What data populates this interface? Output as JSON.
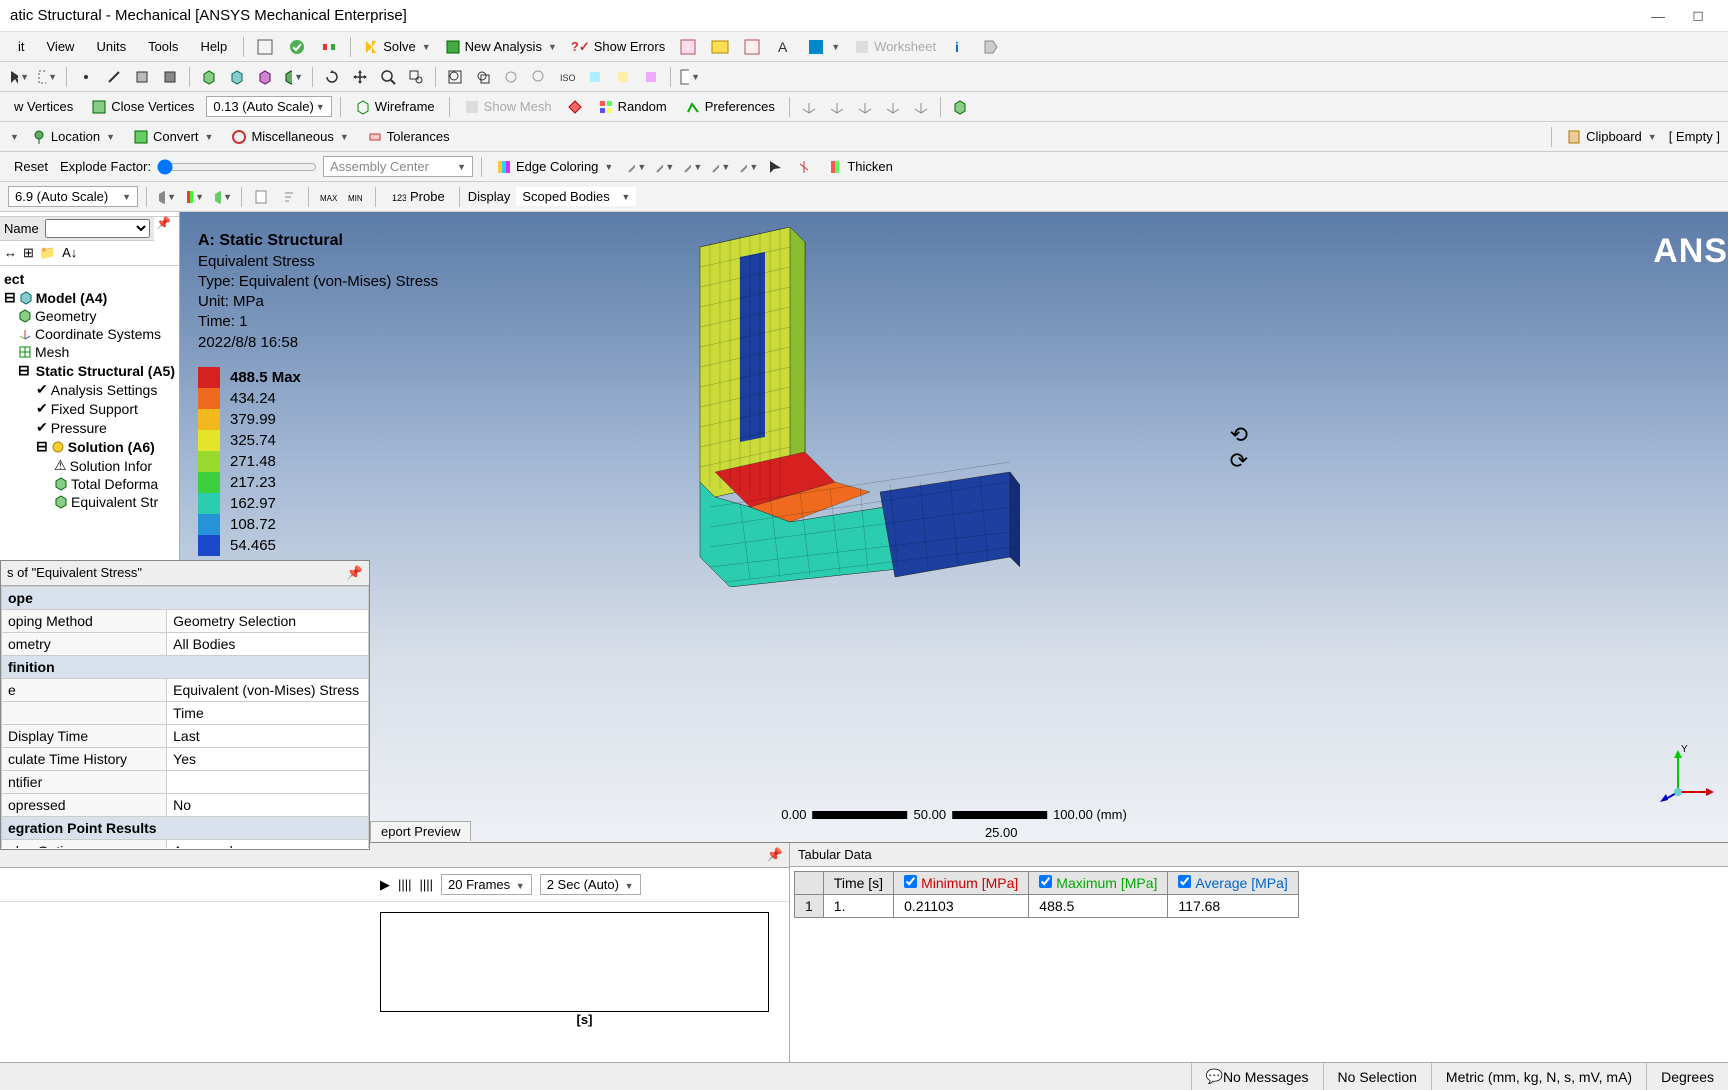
{
  "window": {
    "title": "atic Structural - Mechanical [ANSYS Mechanical Enterprise]"
  },
  "menus": {
    "file": "",
    "edit": "it",
    "view": "View",
    "units": "Units",
    "tools": "Tools",
    "help": "Help"
  },
  "toolbar1": {
    "solve": "Solve",
    "new_analysis": "New Analysis",
    "show_errors": "Show Errors",
    "worksheet": "Worksheet"
  },
  "toolbar3": {
    "vertices": "w Vertices",
    "close_vertices": "Close Vertices",
    "scale": "0.13 (Auto Scale)",
    "wireframe": "Wireframe",
    "show_mesh": "Show Mesh",
    "random": "Random",
    "preferences": "Preferences"
  },
  "toolbar4": {
    "location": "Location",
    "convert": "Convert",
    "misc": "Miscellaneous",
    "tolerances": "Tolerances",
    "clipboard": "Clipboard",
    "empty": "[ Empty ]"
  },
  "toolbar5": {
    "reset": "Reset",
    "explode": "Explode Factor:",
    "assembly": "Assembly Center",
    "edge_coloring": "Edge Coloring",
    "thicken": "Thicken"
  },
  "toolbar6": {
    "autoscale": "6.9 (Auto Scale)",
    "probe": "Probe",
    "display": "Display",
    "scoped": "Scoped Bodies"
  },
  "tree": {
    "filter_label": "Name",
    "project": "ect",
    "model": "Model (A4)",
    "geometry": "Geometry",
    "coord": "Coordinate Systems",
    "mesh": "Mesh",
    "static": "Static Structural (A5)",
    "analysis_settings": "Analysis Settings",
    "fixed_support": "Fixed Support",
    "pressure": "Pressure",
    "solution": "Solution (A6)",
    "solution_info": "Solution Infor",
    "total_deform": "Total Deforma",
    "equiv_stress": "Equivalent Str"
  },
  "viewport": {
    "title": "A: Static Structural",
    "subtitle": "Equivalent Stress",
    "type": "Type: Equivalent (von-Mises) Stress",
    "unit": "Unit: MPa",
    "time": "Time: 1",
    "date": "2022/8/8 16:58",
    "brand": "ANS",
    "scale_min": "0.00",
    "scale_mid": "25.00",
    "scale_50": "50.00",
    "scale_max": "100.00 (mm)",
    "axis_y": "Y"
  },
  "legend": [
    {
      "c": "#d72020",
      "v": "488.5 Max",
      "b": true
    },
    {
      "c": "#ef6a1f",
      "v": "434.24"
    },
    {
      "c": "#f2b81e",
      "v": "379.99"
    },
    {
      "c": "#e4e528",
      "v": "325.74"
    },
    {
      "c": "#98d92d",
      "v": "271.48"
    },
    {
      "c": "#3dcf3d",
      "v": "217.23"
    },
    {
      "c": "#2bccb0",
      "v": "162.97"
    },
    {
      "c": "#2793d6",
      "v": "108.72"
    },
    {
      "c": "#1c49c9",
      "v": "54.465"
    }
  ],
  "details": {
    "title": "s of \"Equivalent Stress\"",
    "sections": {
      "scope": "ope",
      "definition": "finition",
      "integration": "egration Point Results"
    },
    "rows": {
      "scoping_method_k": "oping Method",
      "scoping_method_v": "Geometry Selection",
      "geometry_k": "ometry",
      "geometry_v": "All Bodies",
      "type_k": "e",
      "type_v": "Equivalent (von-Mises) Stress",
      "by_k": "",
      "by_v": "Time",
      "display_time_k": "Display Time",
      "display_time_v": "Last",
      "calc_hist_k": "culate Time History",
      "calc_hist_v": "Yes",
      "identifier_k": "ntifier",
      "identifier_v": "",
      "suppressed_k": "opressed",
      "suppressed_v": "No",
      "display_opt_k": "olav Option",
      "display_opt_v": "Averaged"
    }
  },
  "graph": {
    "tab": "eport Preview",
    "frames": "20 Frames",
    "sec": "2 Sec (Auto)",
    "xlabel": "[s]"
  },
  "tabular": {
    "title": "Tabular Data",
    "headers": {
      "time": "Time [s]",
      "min": "Minimum [MPa]",
      "max": "Maximum [MPa]",
      "avg": "Average [MPa]"
    },
    "row": {
      "idx": "1",
      "time": "1.",
      "min": "0.21103",
      "max": "488.5",
      "avg": "117.68"
    }
  },
  "status": {
    "messages": "No Messages",
    "selection": "No Selection",
    "units": "Metric (mm, kg, N, s, mV, mA)",
    "angle": "Degrees"
  },
  "chart_data": {
    "type": "table",
    "title": "Equivalent (von-Mises) Stress Result",
    "unit": "MPa",
    "legend_values": [
      488.5,
      434.24,
      379.99,
      325.74,
      271.48,
      217.23,
      162.97,
      108.72,
      54.465
    ],
    "tabular": {
      "time_s": 1.0,
      "minimum_MPa": 0.21103,
      "maximum_MPa": 488.5,
      "average_MPa": 117.68
    }
  }
}
